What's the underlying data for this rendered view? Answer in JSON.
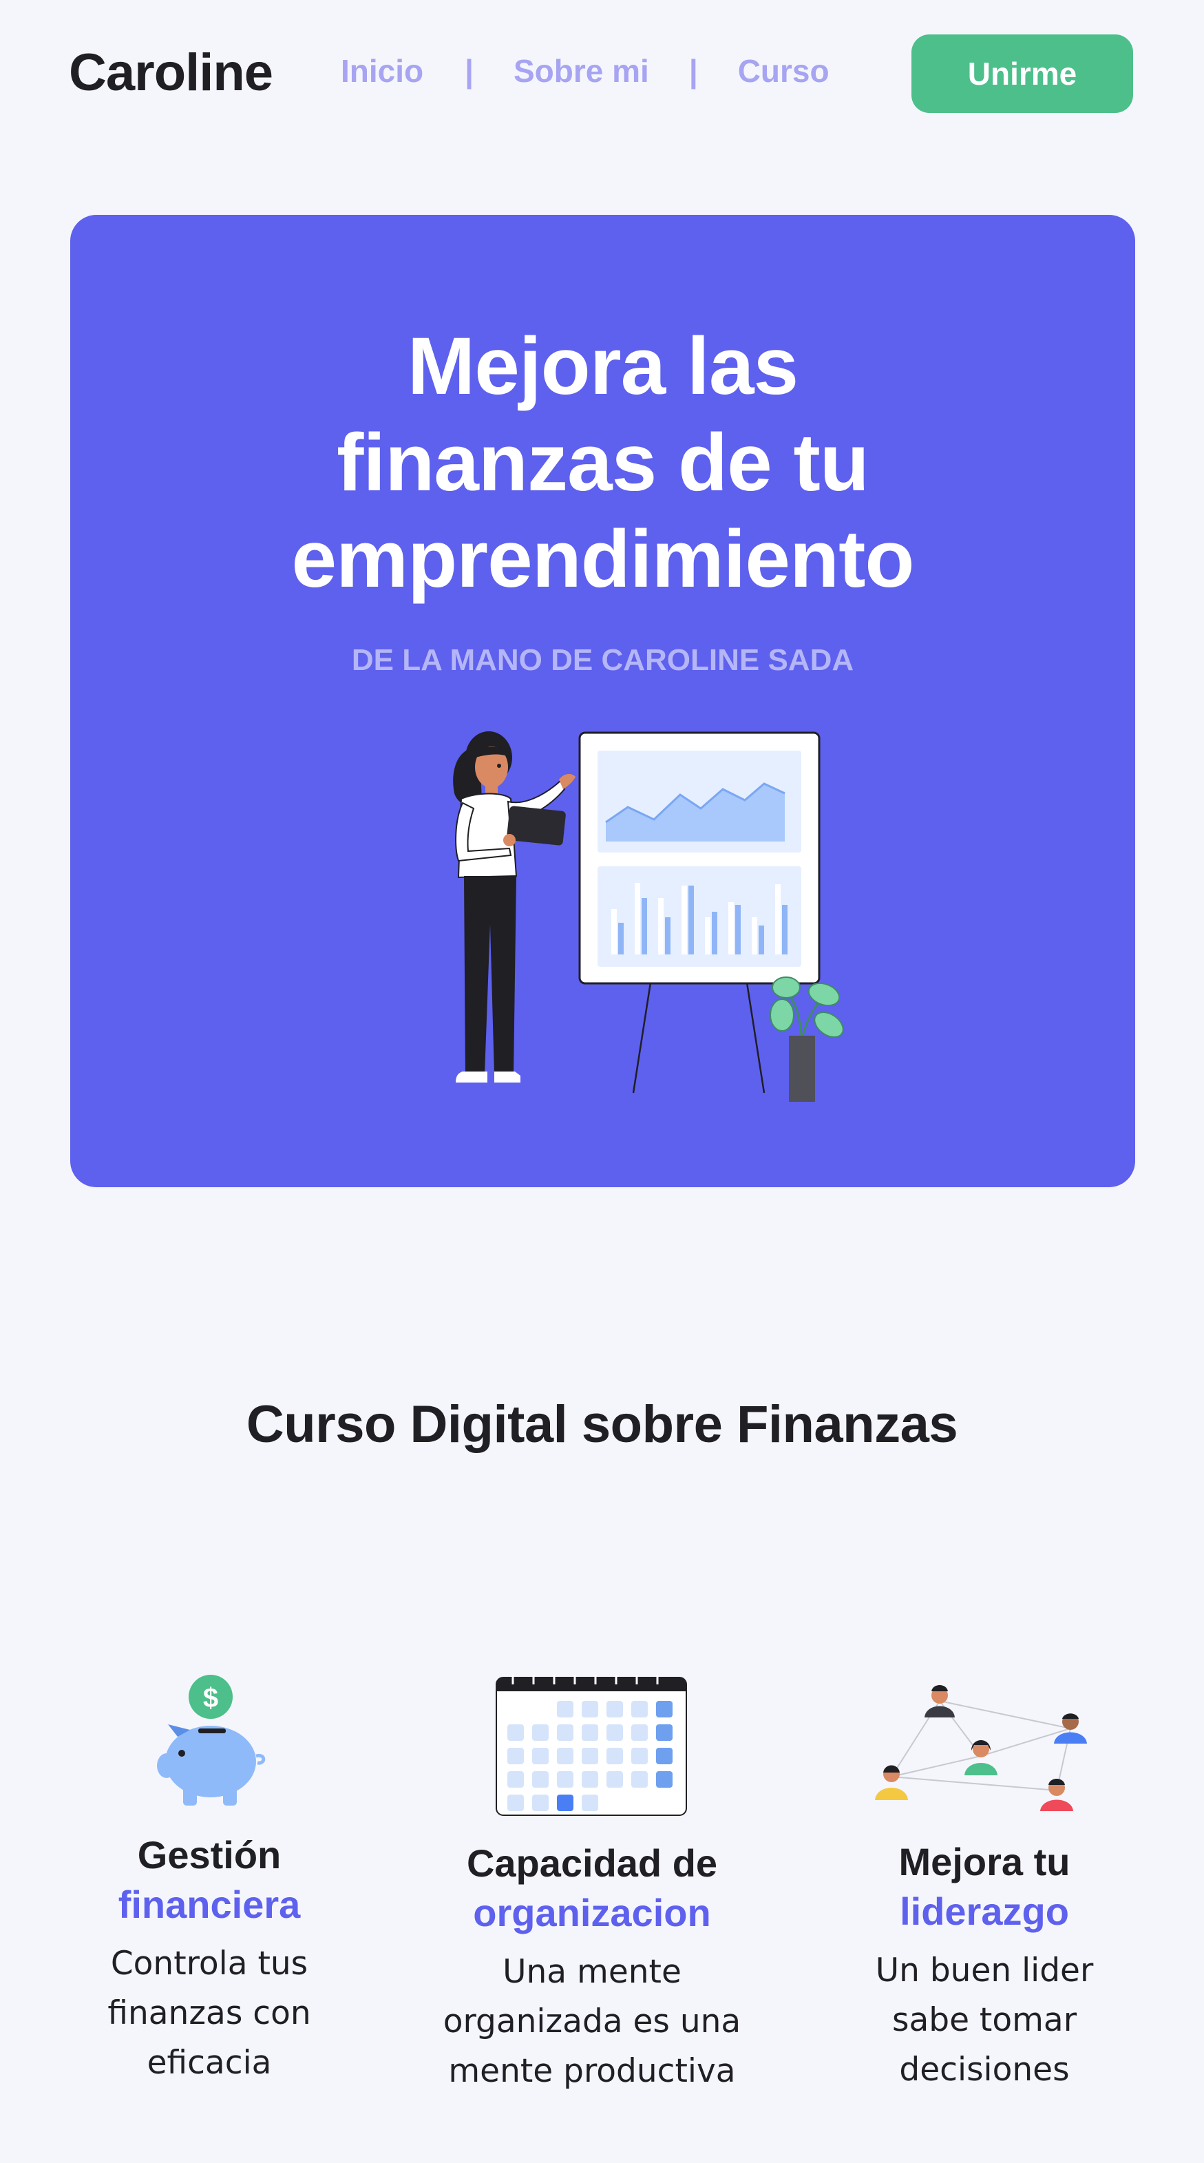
{
  "header": {
    "brand": "Caroline",
    "nav": [
      "Inicio",
      "Sobre mi",
      "Curso"
    ],
    "separator": "|",
    "join_label": "Unirme"
  },
  "hero": {
    "title_lines": [
      "Mejora las",
      "finanzas de tu",
      "emprendimiento"
    ],
    "subtitle": "DE LA MANO DE CAROLINE SADA",
    "bg_color": "#5e60ee"
  },
  "course": {
    "title": "Curso Digital sobre Finanzas",
    "features": [
      {
        "icon": "piggy-bank-icon",
        "title": "Gestión",
        "accent": "financiera",
        "desc_lines": [
          "Controla tus",
          "finanzas con",
          "eficacia"
        ]
      },
      {
        "icon": "calendar-icon",
        "title": "Capacidad de",
        "accent": "organizacion",
        "desc_lines": [
          "Una mente",
          "organizada es una",
          "mente productiva"
        ]
      },
      {
        "icon": "team-network-icon",
        "title": "Mejora tu",
        "accent": "liderazgo",
        "desc_lines": [
          "Un buen lider",
          "sabe tomar",
          "decisiones"
        ]
      }
    ]
  },
  "colors": {
    "accent": "#5e60ee",
    "nav": "#a7a4f2",
    "button": "#4cbf8a",
    "background": "#f5f6fc"
  }
}
